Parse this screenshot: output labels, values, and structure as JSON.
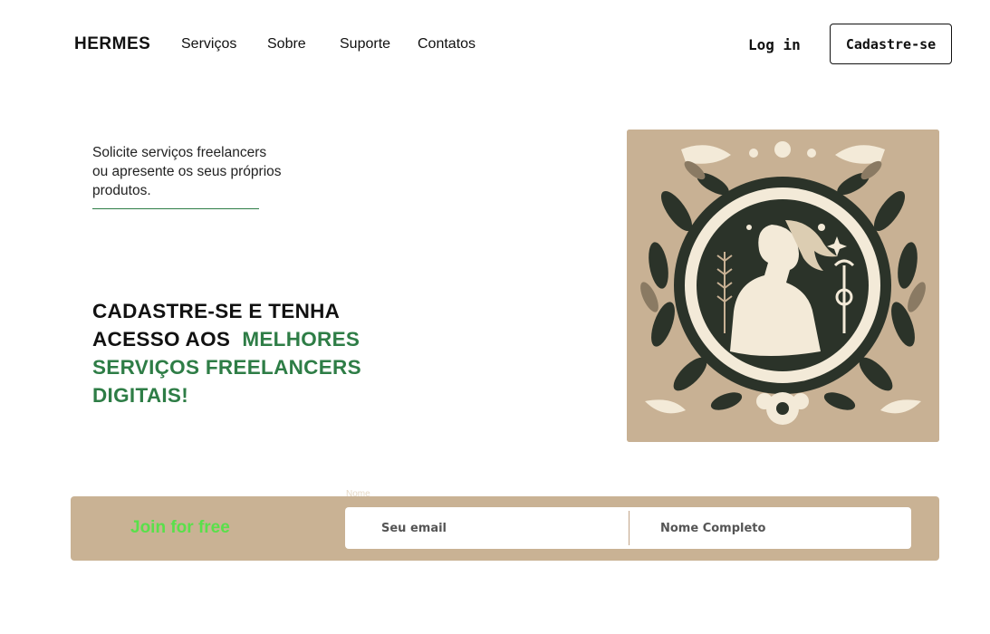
{
  "header": {
    "logo": "HERMES",
    "nav": [
      "Serviços",
      "Sobre",
      "Suporte",
      "Contatos"
    ],
    "login_label": "Log in",
    "signup_label": "Cadastre-se"
  },
  "hero": {
    "tagline": "Solicite serviços freelancers ou apresente os seus próprios produtos.",
    "headline_plain": "CADASTRE-SE E TENHA ACESSO AOS",
    "headline_highlight": "MELHORES SERVIÇOS FREELANCERS DIGITAIS!",
    "image_icon": "hermes-illustration-icon"
  },
  "join": {
    "label": "Join for free",
    "faint_label": "Nome",
    "email_placeholder": "Seu email",
    "name_placeholder": "Nome Completo"
  },
  "colors": {
    "accent_green": "#2e7d46",
    "join_green": "#59e04a",
    "beige": "#c9b294",
    "dark": "#2b3329",
    "cream": "#f3ead8"
  }
}
